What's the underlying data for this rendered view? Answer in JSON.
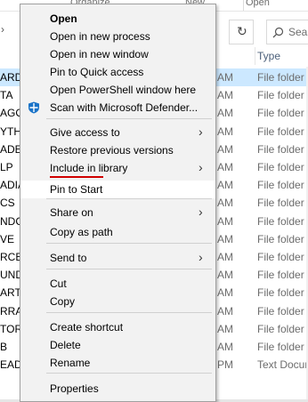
{
  "explorer": {
    "ribbon": {
      "left_label": "Organize",
      "mid_label": "New",
      "right_label": "Open"
    },
    "search_placeholder": "Sea",
    "column_type": "Type",
    "rows": [
      {
        "name": "ARDS",
        "time": "AM",
        "type": "File folder",
        "selected": true
      },
      {
        "name": "TA",
        "time": "AM",
        "type": "File folder"
      },
      {
        "name": "AGO",
        "time": "AM",
        "type": "File folder"
      },
      {
        "name": "YTH",
        "time": "AM",
        "type": "File folder"
      },
      {
        "name": "ADES",
        "time": "AM",
        "type": "File folder"
      },
      {
        "name": "LP",
        "time": "AM",
        "type": "File folder"
      },
      {
        "name": "ADIA",
        "time": "AM",
        "type": "File folder"
      },
      {
        "name": "CS",
        "time": "AM",
        "type": "File folder"
      },
      {
        "name": "NDC",
        "time": "AM",
        "type": "File folder"
      },
      {
        "name": "VE",
        "time": "AM",
        "type": "File folder"
      },
      {
        "name": "RCE",
        "time": "AM",
        "type": "File folder"
      },
      {
        "name": "UND",
        "time": "AM",
        "type": "File folder"
      },
      {
        "name": "ART",
        "time": "AM",
        "type": "File folder"
      },
      {
        "name": "RRA",
        "time": "AM",
        "type": "File folder"
      },
      {
        "name": "TOR",
        "time": "AM",
        "type": "File folder"
      },
      {
        "name": "B",
        "time": "AM",
        "type": "File folder"
      },
      {
        "name": "EAD",
        "time": "PM",
        "type": "Text Docum"
      }
    ]
  },
  "menu": {
    "items": [
      {
        "label": "Open",
        "bold": true
      },
      {
        "label": "Open in new process"
      },
      {
        "label": "Open in new window"
      },
      {
        "label": "Pin to Quick access"
      },
      {
        "label": "Open PowerShell window here"
      },
      {
        "label": "Scan with Microsoft Defender...",
        "icon": "defender-shield-icon"
      },
      {
        "label": "Give access to",
        "submenu": true
      },
      {
        "label": "Restore previous versions"
      },
      {
        "label": "Include in library",
        "submenu": true
      },
      {
        "label": "Pin to Start",
        "highlighted": true,
        "annotation_color": "#d00000"
      },
      {
        "label": "Share on",
        "submenu": true
      },
      {
        "label": "Copy as path"
      },
      {
        "label": "Send to",
        "submenu": true
      },
      {
        "label": "Cut"
      },
      {
        "label": "Copy"
      },
      {
        "label": "Create shortcut"
      },
      {
        "label": "Delete"
      },
      {
        "label": "Rename"
      },
      {
        "label": "Properties"
      }
    ]
  }
}
